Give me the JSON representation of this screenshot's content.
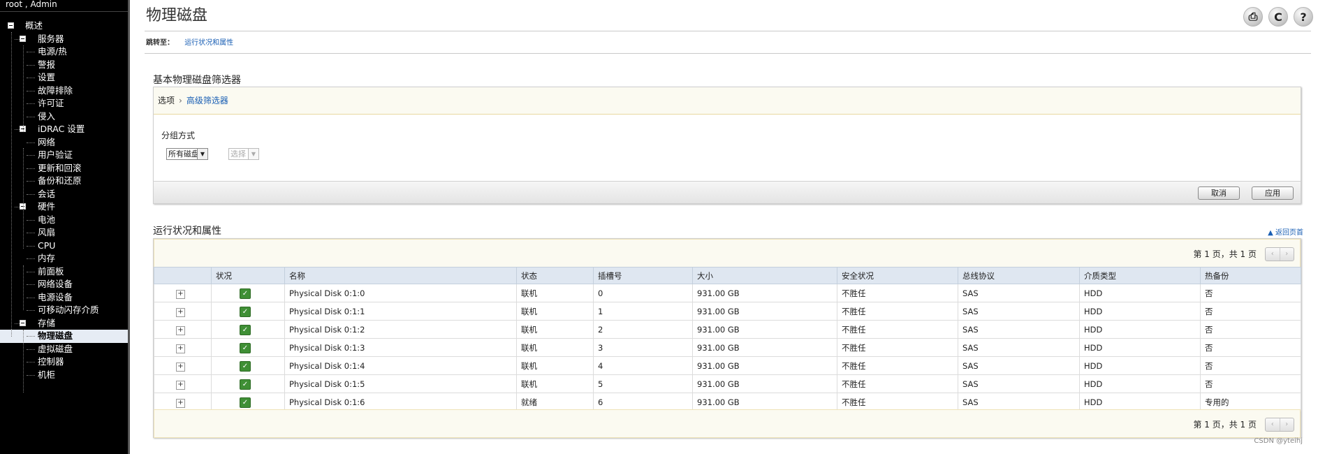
{
  "sidebar": {
    "user": "root , Admin",
    "tree": [
      {
        "label": "概述",
        "level": 0,
        "expanded": true
      },
      {
        "label": "服务器",
        "level": 1,
        "expanded": true
      },
      {
        "label": "电源/热",
        "level": 2
      },
      {
        "label": "警报",
        "level": 2
      },
      {
        "label": "设置",
        "level": 2
      },
      {
        "label": "故障排除",
        "level": 2
      },
      {
        "label": "许可证",
        "level": 2
      },
      {
        "label": "侵入",
        "level": 2
      },
      {
        "label": "iDRAC 设置",
        "level": 1,
        "expanded": true
      },
      {
        "label": "网络",
        "level": 2
      },
      {
        "label": "用户验证",
        "level": 2
      },
      {
        "label": "更新和回滚",
        "level": 2
      },
      {
        "label": "备份和还原",
        "level": 2
      },
      {
        "label": "会话",
        "level": 2
      },
      {
        "label": "硬件",
        "level": 1,
        "expanded": true
      },
      {
        "label": "电池",
        "level": 2
      },
      {
        "label": "风扇",
        "level": 2
      },
      {
        "label": "CPU",
        "level": 2
      },
      {
        "label": "内存",
        "level": 2
      },
      {
        "label": "前面板",
        "level": 2
      },
      {
        "label": "网络设备",
        "level": 2
      },
      {
        "label": "电源设备",
        "level": 2
      },
      {
        "label": "可移动闪存介质",
        "level": 2
      },
      {
        "label": "存储",
        "level": 1,
        "expanded": true
      },
      {
        "label": "物理磁盘",
        "level": 2,
        "selected": true
      },
      {
        "label": "虚拟磁盘",
        "level": 2
      },
      {
        "label": "控制器",
        "level": 2
      },
      {
        "label": "机柜",
        "level": 2
      }
    ]
  },
  "header": {
    "title": "物理磁盘",
    "tools": [
      {
        "name": "print-icon",
        "glyph": "⎙"
      },
      {
        "name": "refresh-icon",
        "glyph": "C"
      },
      {
        "name": "help-icon",
        "glyph": "?"
      }
    ],
    "jump_label": "跳转至：",
    "jump_link": "运行状况和属性"
  },
  "filter": {
    "title": "基本物理磁盘筛选器",
    "tab_options": "选项",
    "tab_advanced": "高级筛选器",
    "group_label": "分组方式",
    "group_value": "所有磁盘",
    "select_placeholder": "选择",
    "cancel_label": "取消",
    "apply_label": "应用"
  },
  "health": {
    "title": "运行状况和属性",
    "back_to_top": "▲ 返回页首",
    "pager": "第 1 页，共 1 页",
    "prev": "‹",
    "next": "›",
    "columns": [
      "",
      "状况",
      "名称",
      "状态",
      "插槽号",
      "大小",
      "安全状况",
      "总线协议",
      "介质类型",
      "热备份"
    ],
    "rows": [
      {
        "name": "Physical Disk 0:1:0",
        "state": "联机",
        "slot": "0",
        "size": "931.00 GB",
        "security": "不胜任",
        "bus": "SAS",
        "media": "HDD",
        "hotspare": "否"
      },
      {
        "name": "Physical Disk 0:1:1",
        "state": "联机",
        "slot": "1",
        "size": "931.00 GB",
        "security": "不胜任",
        "bus": "SAS",
        "media": "HDD",
        "hotspare": "否"
      },
      {
        "name": "Physical Disk 0:1:2",
        "state": "联机",
        "slot": "2",
        "size": "931.00 GB",
        "security": "不胜任",
        "bus": "SAS",
        "media": "HDD",
        "hotspare": "否"
      },
      {
        "name": "Physical Disk 0:1:3",
        "state": "联机",
        "slot": "3",
        "size": "931.00 GB",
        "security": "不胜任",
        "bus": "SAS",
        "media": "HDD",
        "hotspare": "否"
      },
      {
        "name": "Physical Disk 0:1:4",
        "state": "联机",
        "slot": "4",
        "size": "931.00 GB",
        "security": "不胜任",
        "bus": "SAS",
        "media": "HDD",
        "hotspare": "否"
      },
      {
        "name": "Physical Disk 0:1:5",
        "state": "联机",
        "slot": "5",
        "size": "931.00 GB",
        "security": "不胜任",
        "bus": "SAS",
        "media": "HDD",
        "hotspare": "否"
      },
      {
        "name": "Physical Disk 0:1:6",
        "state": "就绪",
        "slot": "6",
        "size": "931.00 GB",
        "security": "不胜任",
        "bus": "SAS",
        "media": "HDD",
        "hotspare": "专用的"
      }
    ]
  },
  "watermark": "CSDN @yteihj",
  "colors": {
    "sidebar_bg": "#000000",
    "link": "#1a5fb4",
    "ok_green": "#3f8f35",
    "header_bg": "#dfe7f1"
  }
}
